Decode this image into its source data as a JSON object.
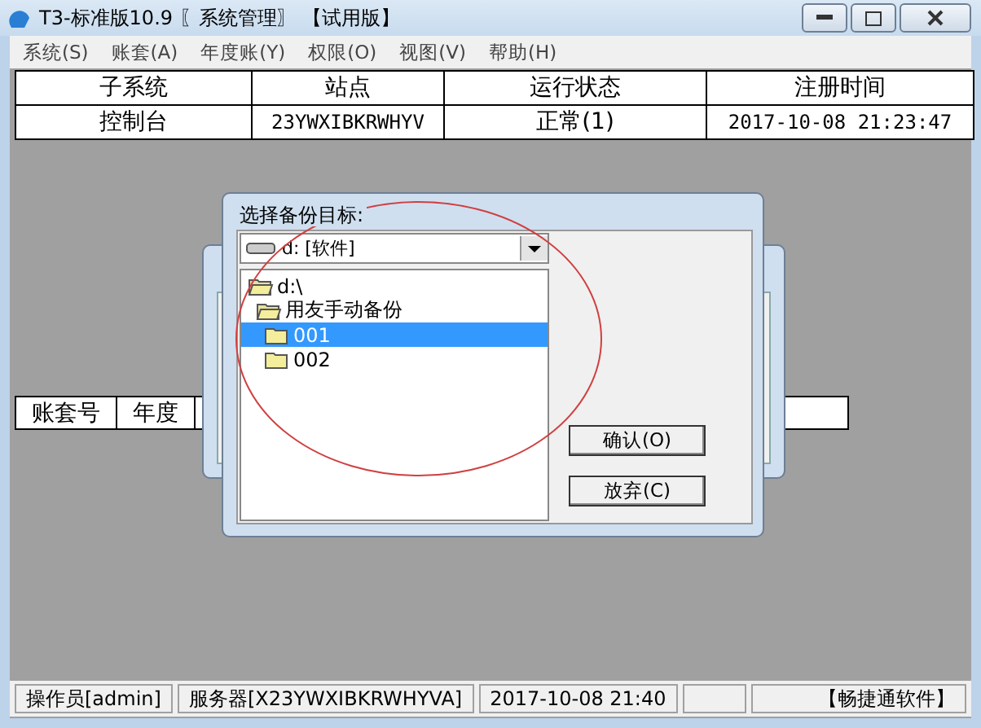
{
  "window": {
    "title": "T3-标准版10.9 〖系统管理〗 【试用版】"
  },
  "menu": [
    "系统(S)",
    "账套(A)",
    "年度账(Y)",
    "权限(O)",
    "视图(V)",
    "帮助(H)"
  ],
  "table": {
    "columns": [
      "子系统",
      "站点",
      "运行状态",
      "注册时间"
    ],
    "rows": [
      [
        "控制台",
        "23YWXIBKRWHYV",
        "正常(1)",
        "2017-10-08 21:23:47"
      ]
    ]
  },
  "account_table": {
    "columns": [
      "账套号",
      "年度"
    ]
  },
  "dialog": {
    "title": "选择备份目标:",
    "drive": "d: [软件]",
    "folders": [
      {
        "name": "d:\\",
        "open": true,
        "selected": false,
        "children": [
          {
            "name": "用友手动备份",
            "open": true,
            "selected": false,
            "children": [
              {
                "name": "001",
                "open": false,
                "selected": true
              },
              {
                "name": "002",
                "open": false,
                "selected": false
              }
            ]
          }
        ]
      }
    ],
    "buttons": [
      "确认(O)",
      "放弃(C)"
    ]
  },
  "status_bar": [
    "操作员[admin]",
    "服务器[X23YWXIBKRWHYVA]",
    "2017-10-08 21:40",
    "【畅捷通软件】"
  ]
}
